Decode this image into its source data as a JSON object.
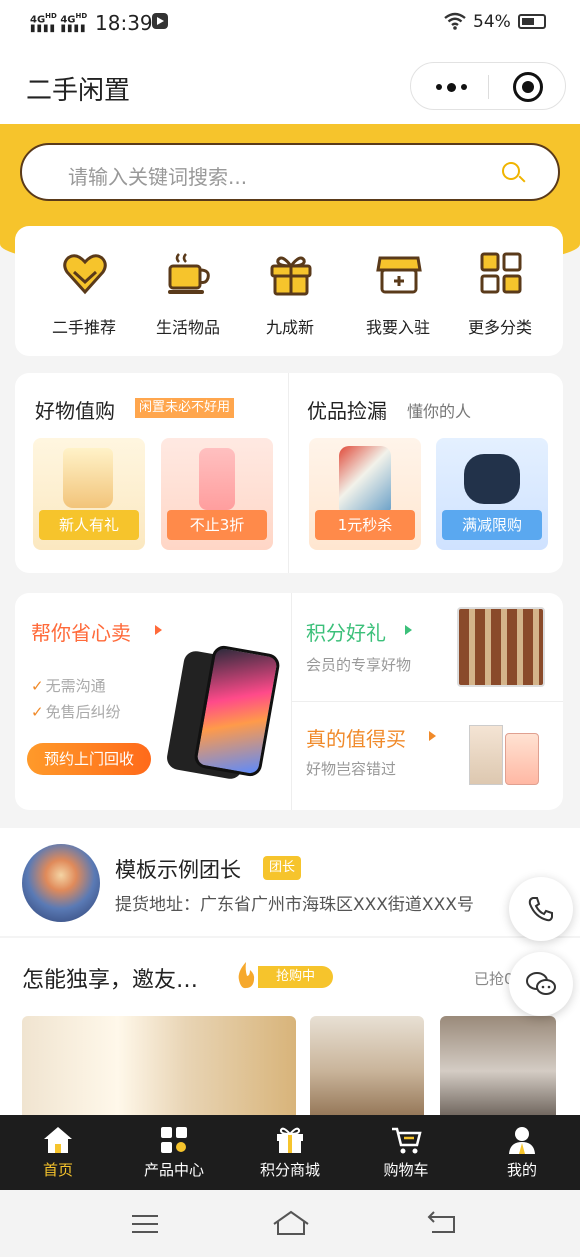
{
  "status": {
    "signal": "4GHD",
    "time": "18:39",
    "battery": "54%"
  },
  "header": {
    "title": "二手闲置"
  },
  "search": {
    "placeholder": "请输入关键词搜索..."
  },
  "categories": [
    {
      "label": "二手推荐",
      "icon": "heart-icon"
    },
    {
      "label": "生活物品",
      "icon": "cup-icon"
    },
    {
      "label": "九成新",
      "icon": "gift-icon"
    },
    {
      "label": "我要入驻",
      "icon": "store-icon"
    },
    {
      "label": "更多分类",
      "icon": "grid-icon"
    }
  ],
  "deals": {
    "left_title": "好物值购",
    "left_tag": "闲置未必不好用",
    "right_title": "优品捡漏",
    "right_sub": "懂你的人",
    "items": [
      {
        "label": "新人有礼"
      },
      {
        "label": "不止3折"
      },
      {
        "label": "1元秒杀"
      },
      {
        "label": "满减限购"
      }
    ]
  },
  "promo": {
    "sell_title": "帮你省心卖",
    "check1": "无需沟通",
    "check2": "免售后纠纷",
    "sell_button": "预约上门回收",
    "points_title": "积分好礼",
    "points_sub": "会员的专享好物",
    "worth_title": "真的值得买",
    "worth_sub": "好物岂容错过"
  },
  "leader": {
    "name": "模板示例团长",
    "badge": "团长",
    "address": "提货地址：广东省广州市海珠区XXX街道XXX号"
  },
  "share": {
    "title": "怎能独享，邀友…",
    "status": "抢购中",
    "right": "已抢0"
  },
  "tabbar": [
    {
      "label": "首页",
      "icon": "home-icon"
    },
    {
      "label": "产品中心",
      "icon": "product-center-icon"
    },
    {
      "label": "积分商城",
      "icon": "points-gift-icon"
    },
    {
      "label": "购物车",
      "icon": "cart-icon"
    },
    {
      "label": "我的",
      "icon": "profile-icon"
    }
  ],
  "colors": {
    "accent": "#f6c42c",
    "brown": "#5a3a1a",
    "orange": "#ff7a2a",
    "green": "#3cc07a"
  }
}
